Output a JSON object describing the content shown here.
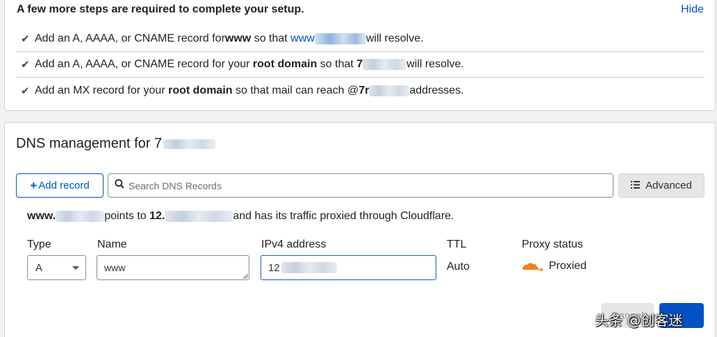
{
  "setup": {
    "title": "A few more steps are required to complete your setup.",
    "hide_label": "Hide",
    "steps": [
      {
        "check": "✔",
        "p1": "Add an A, AAAA, or CNAME record for ",
        "bold": "www",
        "p2": " so that ",
        "link": "www",
        "end": "will resolve."
      },
      {
        "check": "✔",
        "p1": "Add an A, AAAA, or CNAME record for your ",
        "bold": "root domain",
        "p2": " so that ",
        "strong2": "7",
        "end": "will resolve."
      },
      {
        "check": "✔",
        "p1": "Add an MX record for your ",
        "bold": "root domain",
        "p2": " so that mail can reach @",
        "strong2": "7r",
        "end": "addresses."
      }
    ]
  },
  "dns": {
    "title": "DNS management for 7",
    "add_record_label": "Add record",
    "add_record_plus": "+",
    "search_placeholder": "Search DNS Records",
    "advanced_label": "Advanced",
    "points": {
      "host": "www.",
      "mid": "points to ",
      "ip": "12.",
      "end": "and has its traffic proxied through Cloudflare."
    },
    "form": {
      "type_label": "Type",
      "type_value": "A",
      "name_label": "Name",
      "name_value": "www",
      "ip_label": "IPv4 address",
      "ip_value": "12",
      "ttl_label": "TTL",
      "ttl_value": "Auto",
      "proxy_label": "Proxy status",
      "proxy_value": "Proxied"
    },
    "cancel_label": "Cancel"
  },
  "icons": {
    "check": "check-icon",
    "search": "search-icon",
    "advanced": "list-icon",
    "cloud": "cloud-icon"
  },
  "colors": {
    "accent": "#0051c3",
    "cloud_orange": "#f38020"
  },
  "watermark": "头条 @创客迷"
}
